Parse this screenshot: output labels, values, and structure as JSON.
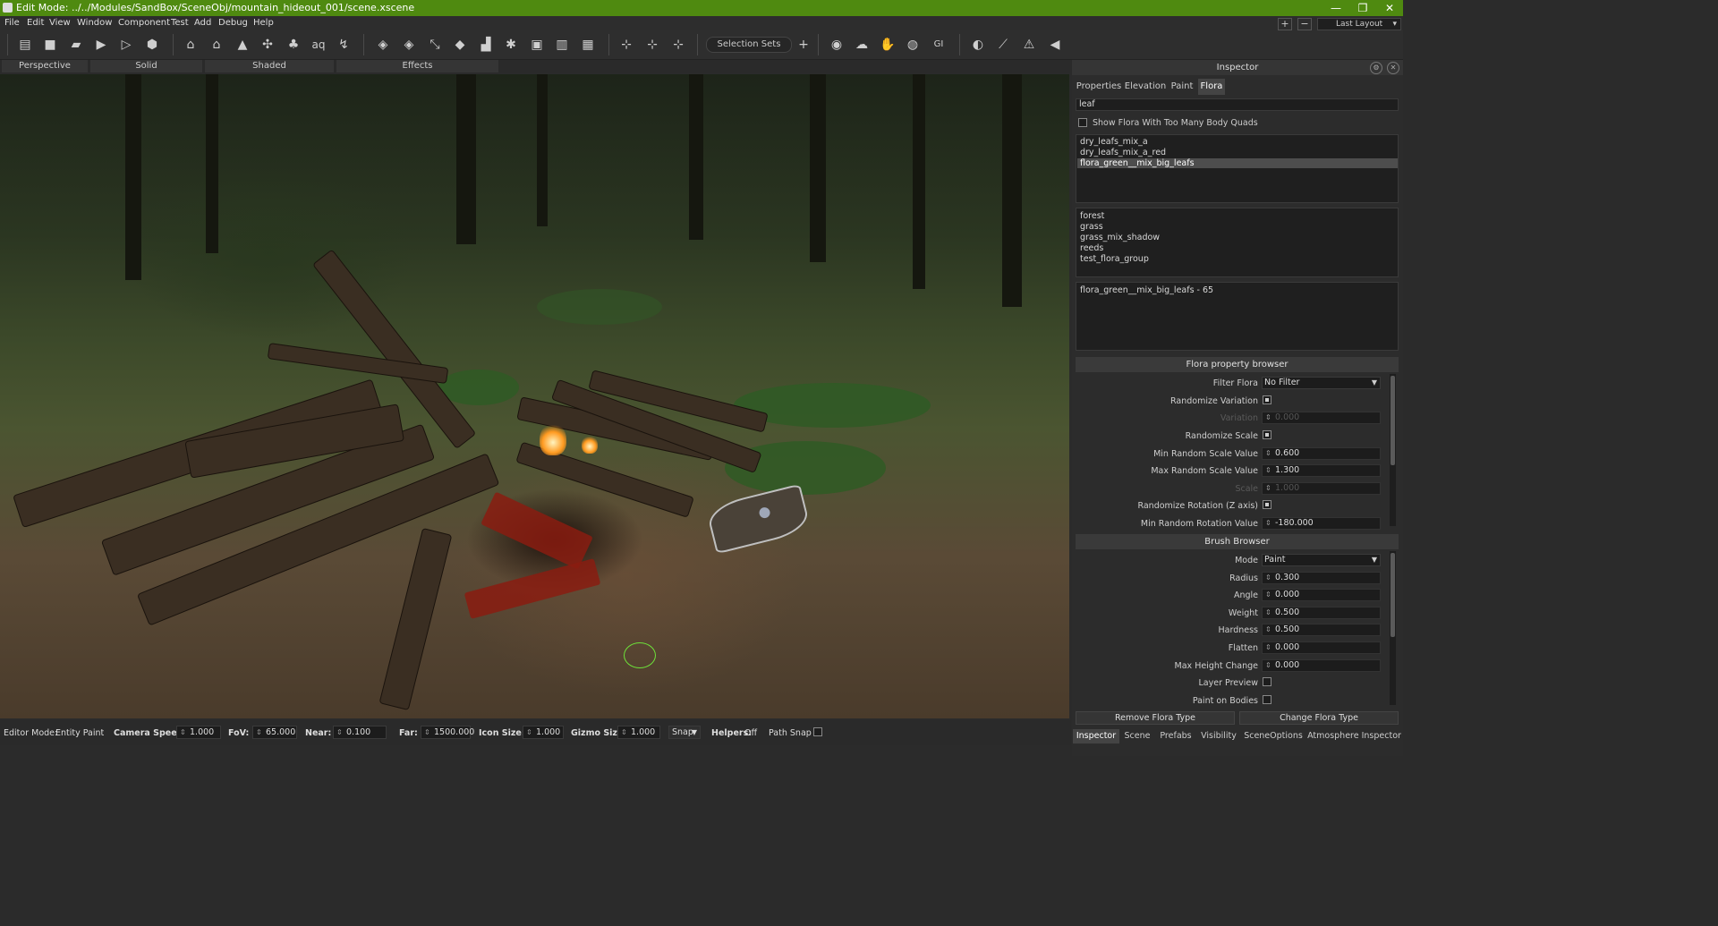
{
  "titlebar": {
    "title": "Edit Mode: ../../Modules/SandBox/SceneObj/mountain_hideout_001/scene.xscene",
    "minimize": "—",
    "restore": "❐",
    "close": "✕",
    "color": "#4f8a10"
  },
  "menu": [
    "File",
    "Edit",
    "View",
    "Window",
    "Component",
    "Test",
    "Add",
    "Debug",
    "Help"
  ],
  "toolbar": {
    "selection_sets": "Selection Sets",
    "add_selection_set": "+",
    "layout_plus": "+",
    "layout_minus": "−",
    "layout": "Last Layout"
  },
  "viewport_tabs": [
    "Perspective",
    "Solid",
    "Shaded",
    "Effects"
  ],
  "inspector": {
    "title": "Inspector",
    "tabs": [
      "Properties",
      "Elevation",
      "Paint",
      "Flora"
    ],
    "active_tab": "Flora",
    "search_value": "leaf",
    "show_flora_quads": "Show Flora With Too Many Body Quads",
    "flora_list": [
      "dry_leafs_mix_a",
      "dry_leafs_mix_a_red",
      "flora_green__mix_big_leafs"
    ],
    "flora_selected": "flora_green__mix_big_leafs",
    "group_list": [
      "forest",
      "grass",
      "grass_mix_shadow",
      "reeds",
      "test_flora_group"
    ],
    "count_list": [
      "flora_green__mix_big_leafs - 65"
    ],
    "flora_browser": {
      "title": "Flora property browser",
      "filter_label": "Filter Flora",
      "filter_value": "No Filter",
      "randomize_variation": "Randomize Variation",
      "variation_label": "Variation",
      "variation_value": "0.000",
      "randomize_scale": "Randomize Scale",
      "min_scale_label": "Min Random Scale Value",
      "min_scale_value": "0.600",
      "max_scale_label": "Max Random Scale Value",
      "max_scale_value": "1.300",
      "scale_label": "Scale",
      "scale_value": "1.000",
      "randomize_rotation": "Randomize Rotation (Z axis)",
      "min_rotation_label": "Min Random Rotation Value",
      "min_rotation_value": "-180.000"
    },
    "brush_browser": {
      "title": "Brush Browser",
      "mode_label": "Mode",
      "mode_value": "Paint",
      "radius_label": "Radius",
      "radius_value": "0.300",
      "angle_label": "Angle",
      "angle_value": "0.000",
      "weight_label": "Weight",
      "weight_value": "0.500",
      "hardness_label": "Hardness",
      "hardness_value": "0.500",
      "flatten_label": "Flatten",
      "flatten_value": "0.000",
      "max_height_label": "Max Height Change",
      "max_height_value": "0.000",
      "layer_preview_label": "Layer Preview",
      "paint_bodies_label": "Paint on Bodies"
    },
    "remove_button": "Remove Flora Type",
    "change_button": "Change Flora Type",
    "bottom_tabs": [
      "Inspector",
      "Scene",
      "Prefabs",
      "Visibility",
      "SceneOptions",
      "Atmosphere Inspector"
    ],
    "active_bottom_tab": "Inspector"
  },
  "statusbar": {
    "editor_mode_label": "Editor Mode:",
    "editor_mode_value": "Entity Paint",
    "camera_speed_label": "Camera Speed:",
    "camera_speed_value": "1.000",
    "fov_label": "FoV:",
    "fov_value": "65.000",
    "near_label": "Near:",
    "near_value": "0.100",
    "far_label": "Far:",
    "far_value": "1500.000",
    "icon_size_label": "Icon Size:",
    "icon_size_value": "1.000",
    "gizmo_size_label": "Gizmo Size",
    "gizmo_size_value": "1.000",
    "snap_label": "Snap",
    "helpers_label": "Helpers:",
    "helpers_value": "Off",
    "path_snap_label": "Path Snap"
  }
}
